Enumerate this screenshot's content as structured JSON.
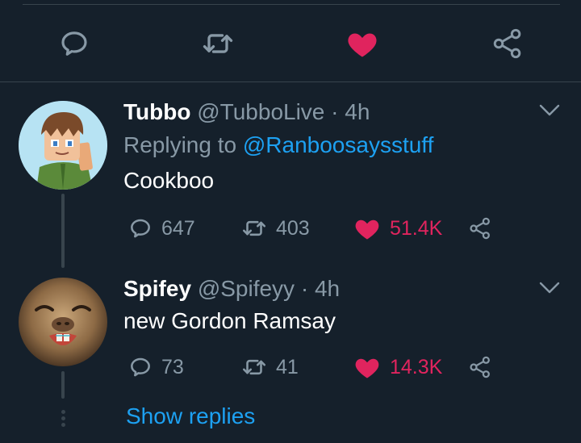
{
  "colors": {
    "background": "#15202b",
    "divider": "#38444d",
    "secondary_text": "#8899a6",
    "link": "#1da1f2",
    "like": "#e0245e"
  },
  "action_bar": {
    "icons": [
      "comment-icon",
      "retweet-icon",
      "heart-filled-icon",
      "share-icon"
    ],
    "liked": true
  },
  "replies": [
    {
      "name": "Tubbo",
      "handle": "@TubboLive",
      "separator": "·",
      "time": "4h",
      "replying_prefix": "Replying to ",
      "replying_to": "@Ranboosaysstuff",
      "text": "Cookboo",
      "comments": "647",
      "retweets": "403",
      "likes": "51.4K",
      "liked": true
    },
    {
      "name": "Spifey",
      "handle": "@Spifeyy",
      "separator": "·",
      "time": "4h",
      "text": "new Gordon Ramsay",
      "comments": "73",
      "retweets": "41",
      "likes": "14.3K",
      "liked": true
    }
  ],
  "show_replies_label": "Show replies"
}
